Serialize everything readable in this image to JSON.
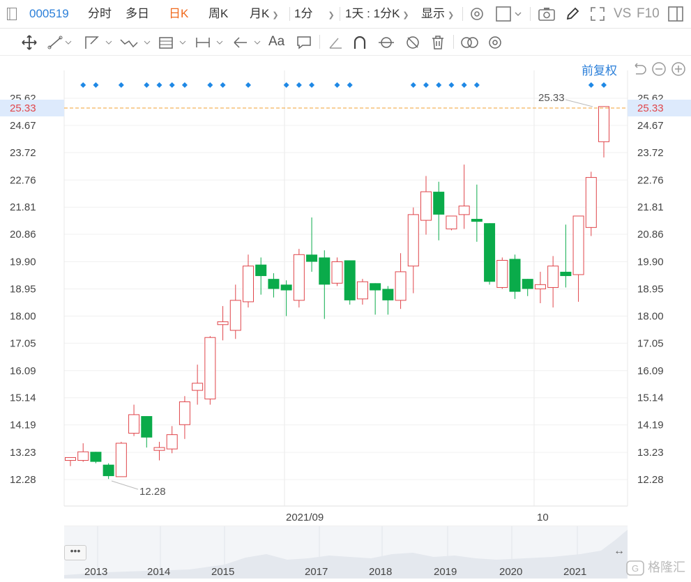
{
  "toolbar": {
    "code": "000519",
    "tabs": [
      {
        "label": "分时",
        "active": false
      },
      {
        "label": "多日",
        "active": false
      },
      {
        "label": "日K",
        "active": true
      },
      {
        "label": "周K",
        "active": false
      },
      {
        "label": "月K",
        "active": false
      }
    ],
    "minute_select": "1分",
    "interval_select": "1天 : 1分K",
    "display_select": "显示",
    "vs_label": "VS",
    "f10_label": "F10"
  },
  "drawing_tools": [
    "move-icon",
    "line-icon",
    "polyline-icon",
    "wave-icon",
    "fib-icon",
    "range-icon",
    "arrow-icon",
    "text-icon",
    "comment-icon",
    "ruler-icon",
    "arc-icon",
    "cycle-icon",
    "hide-icon",
    "trash-icon",
    "overlay-icon",
    "settings-icon"
  ],
  "adjust_label": "前复权",
  "price_axis": [
    "25.62",
    "24.67",
    "23.72",
    "22.76",
    "21.81",
    "20.86",
    "19.90",
    "18.95",
    "18.00",
    "17.05",
    "16.09",
    "15.14",
    "14.19",
    "13.23",
    "12.28"
  ],
  "current_price": "25.33",
  "high_label": "25.33",
  "low_label": "12.28",
  "time_axis": [
    "2021/09",
    "10"
  ],
  "nav_years": [
    "2013",
    "2014",
    "2015",
    "2017",
    "2018",
    "2019",
    "2020",
    "2021"
  ],
  "watermark": "格隆汇",
  "colors": {
    "up": "#e0454a",
    "down": "#0aab4a",
    "accent": "#2b7fd9",
    "active_tab": "#f06a1d",
    "price_line": "#f0a030"
  },
  "chart_data": {
    "type": "candlestick",
    "y_range": [
      12.28,
      25.62
    ],
    "candles": [
      {
        "o": 12.95,
        "h": 13.05,
        "l": 12.75,
        "c": 13.05
      },
      {
        "o": 12.95,
        "h": 13.55,
        "l": 12.9,
        "c": 13.25
      },
      {
        "o": 13.25,
        "h": 13.25,
        "l": 12.85,
        "c": 12.9
      },
      {
        "o": 12.8,
        "h": 12.85,
        "l": 12.3,
        "c": 12.4
      },
      {
        "o": 12.38,
        "h": 13.6,
        "l": 12.38,
        "c": 13.55
      },
      {
        "o": 13.9,
        "h": 14.9,
        "l": 13.8,
        "c": 14.55
      },
      {
        "o": 14.5,
        "h": 14.5,
        "l": 13.4,
        "c": 13.75
      },
      {
        "o": 13.3,
        "h": 13.6,
        "l": 12.95,
        "c": 13.4
      },
      {
        "o": 13.35,
        "h": 14.15,
        "l": 13.2,
        "c": 13.85
      },
      {
        "o": 14.2,
        "h": 15.2,
        "l": 13.7,
        "c": 15.0
      },
      {
        "o": 15.4,
        "h": 16.3,
        "l": 14.9,
        "c": 15.65
      },
      {
        "o": 15.1,
        "h": 17.3,
        "l": 14.9,
        "c": 17.25
      },
      {
        "o": 17.7,
        "h": 18.35,
        "l": 17.15,
        "c": 17.8
      },
      {
        "o": 17.5,
        "h": 19.1,
        "l": 17.2,
        "c": 18.55
      },
      {
        "o": 18.5,
        "h": 20.15,
        "l": 18.3,
        "c": 19.75
      },
      {
        "o": 19.8,
        "h": 20.05,
        "l": 18.75,
        "c": 19.4
      },
      {
        "o": 19.3,
        "h": 19.5,
        "l": 18.65,
        "c": 18.95
      },
      {
        "o": 19.1,
        "h": 19.25,
        "l": 18.0,
        "c": 18.9
      },
      {
        "o": 18.55,
        "h": 20.35,
        "l": 18.3,
        "c": 20.15
      },
      {
        "o": 20.15,
        "h": 21.45,
        "l": 19.55,
        "c": 19.9
      },
      {
        "o": 20.05,
        "h": 20.3,
        "l": 17.9,
        "c": 19.1
      },
      {
        "o": 19.15,
        "h": 20.05,
        "l": 19.05,
        "c": 19.9
      },
      {
        "o": 19.95,
        "h": 19.95,
        "l": 18.4,
        "c": 18.55
      },
      {
        "o": 18.6,
        "h": 19.3,
        "l": 18.4,
        "c": 19.2
      },
      {
        "o": 19.15,
        "h": 19.15,
        "l": 18.05,
        "c": 18.9
      },
      {
        "o": 18.95,
        "h": 19.05,
        "l": 18.05,
        "c": 18.55
      },
      {
        "o": 18.55,
        "h": 20.2,
        "l": 18.25,
        "c": 19.55
      },
      {
        "o": 19.75,
        "h": 21.8,
        "l": 18.8,
        "c": 21.55
      },
      {
        "o": 21.35,
        "h": 22.9,
        "l": 20.85,
        "c": 22.35
      },
      {
        "o": 22.35,
        "h": 22.7,
        "l": 20.65,
        "c": 21.55
      },
      {
        "o": 21.05,
        "h": 21.5,
        "l": 21.0,
        "c": 21.5
      },
      {
        "o": 21.55,
        "h": 23.3,
        "l": 21.05,
        "c": 21.85
      },
      {
        "o": 21.4,
        "h": 22.6,
        "l": 20.6,
        "c": 21.3
      },
      {
        "o": 21.25,
        "h": 21.25,
        "l": 19.1,
        "c": 19.2
      },
      {
        "o": 19.0,
        "h": 20.05,
        "l": 18.95,
        "c": 19.95
      },
      {
        "o": 20.0,
        "h": 20.15,
        "l": 18.6,
        "c": 18.85
      },
      {
        "o": 19.3,
        "h": 19.3,
        "l": 18.7,
        "c": 18.95
      },
      {
        "o": 18.95,
        "h": 19.55,
        "l": 18.45,
        "c": 19.1
      },
      {
        "o": 19.0,
        "h": 20.1,
        "l": 18.3,
        "c": 19.75
      },
      {
        "o": 19.55,
        "h": 21.2,
        "l": 19.0,
        "c": 19.4
      },
      {
        "o": 19.45,
        "h": 21.45,
        "l": 18.5,
        "c": 21.5
      },
      {
        "o": 21.1,
        "h": 23.05,
        "l": 20.8,
        "c": 22.85
      },
      {
        "o": 24.1,
        "h": 25.33,
        "l": 23.55,
        "c": 25.33
      }
    ],
    "event_markers": [
      1,
      2,
      4,
      6,
      7,
      8,
      9,
      11,
      12,
      14,
      17,
      18,
      19,
      21,
      22,
      27,
      28,
      29,
      30,
      31,
      32,
      41,
      42
    ]
  }
}
